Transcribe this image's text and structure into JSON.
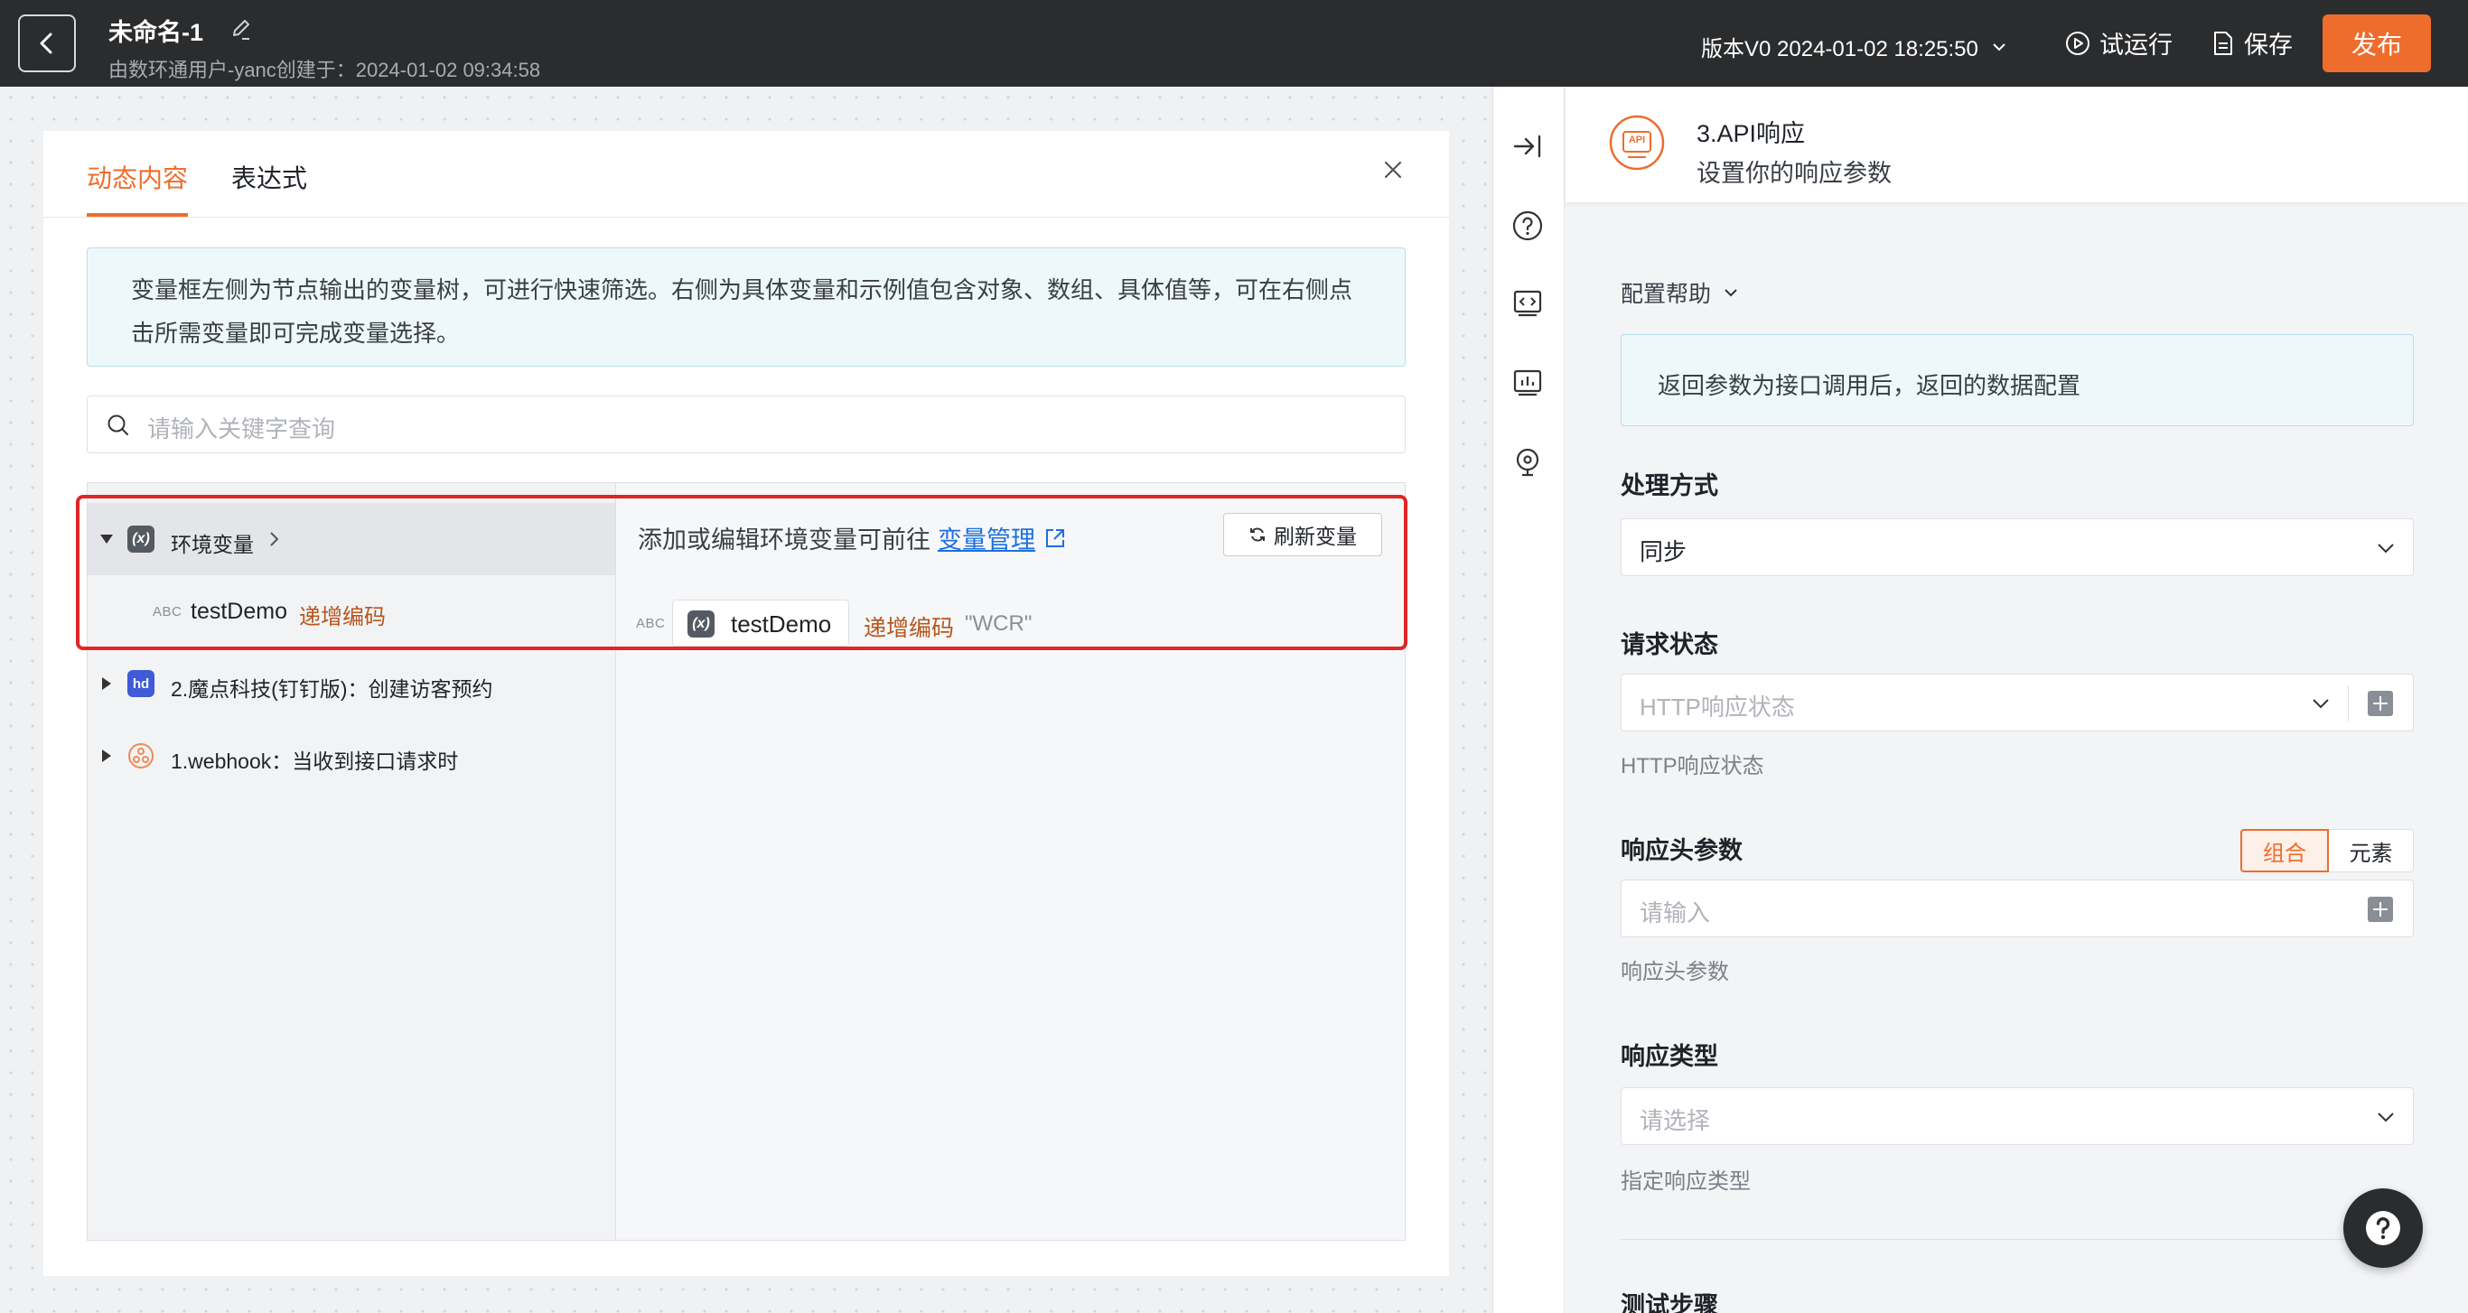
{
  "header": {
    "title": "未命名-1",
    "subtitle": "由数环通用户-yanc创建于：2024-01-02 09:34:58",
    "version": "版本V0 2024-01-02 18:25:50",
    "trial_run": "试运行",
    "save": "保存",
    "publish": "发布"
  },
  "dialog": {
    "tabs": [
      "动态内容",
      "表达式"
    ],
    "info": "变量框左侧为节点输出的变量树，可进行快速筛选。右侧为具体变量和示例值包含对象、数组、具体值等，可在右侧点击所需变量即可完成变量选择。",
    "search_placeholder": "请输入关键字查询",
    "tree": {
      "env": "环境变量",
      "env_var_type": "ABC",
      "env_var_name": "testDemo",
      "env_var_tag": "递增编码",
      "node2": "2.魔点科技(钉钉版)：创建访客预约",
      "node1": "1.webhook：当收到接口请求时"
    },
    "right": {
      "hint": "添加或编辑环境变量可前往",
      "link": "变量管理",
      "refresh": "刷新变量",
      "var_type": "ABC",
      "var_name": "testDemo",
      "var_tag": "递增编码",
      "var_value": "\"WCR\""
    }
  },
  "right_panel": {
    "title": "3.API响应",
    "subtitle": "设置你的响应参数",
    "api_badge": "API",
    "config_help": "配置帮助",
    "return_info": "返回参数为接口调用后，返回的数据配置",
    "process_label": "处理方式",
    "process_value": "同步",
    "status_label": "请求状态",
    "status_placeholder": "HTTP响应状态",
    "status_help": "HTTP响应状态",
    "headers_label": "响应头参数",
    "seg_combined": "组合",
    "seg_element": "元素",
    "headers_placeholder": "请输入",
    "headers_help": "响应头参数",
    "type_label": "响应类型",
    "type_placeholder": "请选择",
    "type_help": "指定响应类型",
    "next_label": "测试步骤"
  },
  "colors": {
    "accent": "#ee6d2c",
    "link": "#1d6fe0",
    "highlight": "#e02626",
    "topbar": "#2b2c2e"
  }
}
